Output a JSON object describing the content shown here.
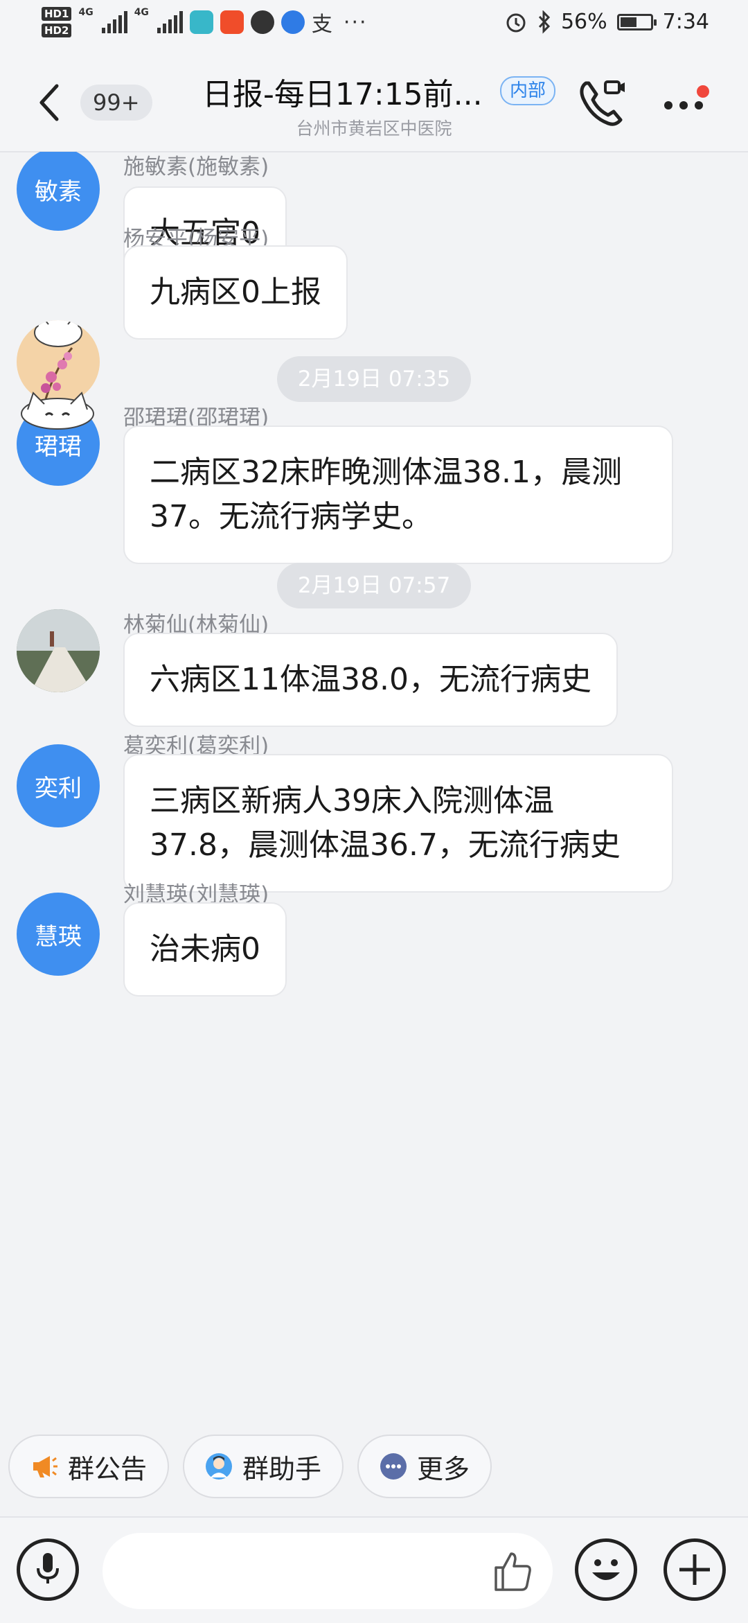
{
  "status_bar": {
    "hd1": "HD1",
    "hd2": "HD2",
    "net1": "4G",
    "net2": "4G",
    "more": "···",
    "battery_text": "56%",
    "battery_level": 0.56,
    "time": "7:34"
  },
  "header": {
    "unread": "99+",
    "title": "日报-每日17:15前...",
    "tag": "内部",
    "subtitle": "台州市黄岩区中医院"
  },
  "messages": [
    {
      "sender": "施敏素(施敏素)",
      "avatar_text": "敏素",
      "text": "大五官0"
    },
    {
      "sender": "杨安平(杨安平)",
      "avatar_text": "",
      "text": "九病区0上报"
    },
    {
      "sender": "邵珺珺(邵珺珺)",
      "avatar_text": "珺珺",
      "text": "二病区32床昨晚测体温38.1，晨测37。无流行病学史。"
    },
    {
      "sender": "林菊仙(林菊仙)",
      "avatar_text": "",
      "text": "六病区11体温38.0，无流行病史"
    },
    {
      "sender": "葛奕利(葛奕利)",
      "avatar_text": "奕利",
      "text": "三病区新病人39床入院测体温37.8，晨测体温36.7，无流行病史"
    },
    {
      "sender": "刘慧瑛(刘慧瑛)",
      "avatar_text": "慧瑛",
      "text": "治未病0"
    }
  ],
  "timestamps": [
    "2月19日 07:35",
    "2月19日 07:57"
  ],
  "quick_actions": {
    "announcement": "群公告",
    "assistant": "群助手",
    "more": "更多"
  },
  "colors": {
    "avatar_blue": "#3f8ff0",
    "accent": "#2c83ea",
    "notification_dot": "#f0473c"
  }
}
